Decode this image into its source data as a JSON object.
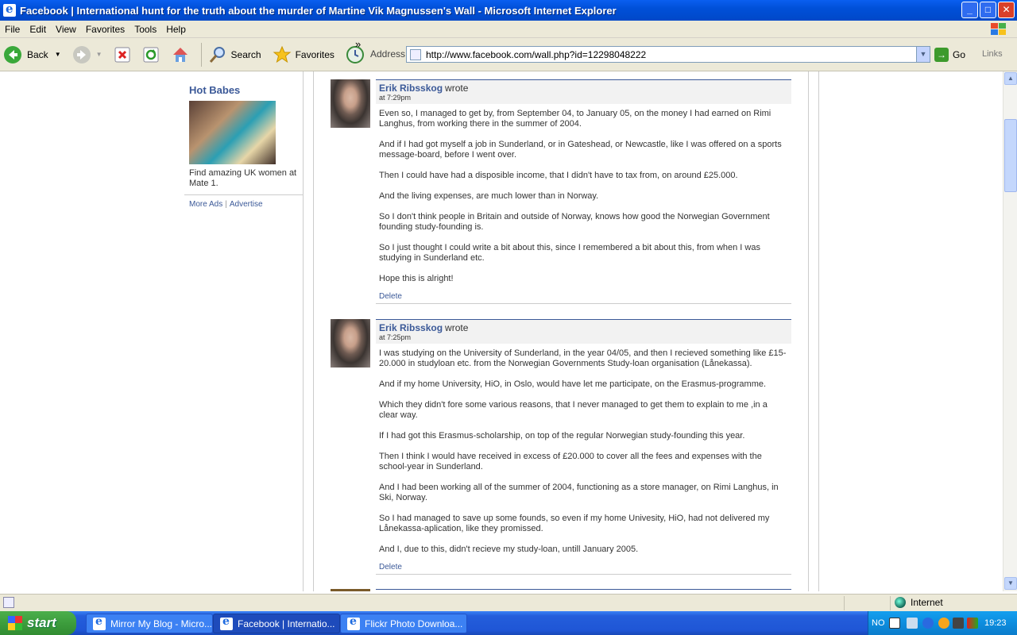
{
  "window": {
    "title": "Facebook | International hunt for the truth about the murder of Martine Vik Magnussen's Wall - Microsoft Internet Explorer",
    "controls": {
      "minimize": "_",
      "maximize": "□",
      "close": "✕"
    }
  },
  "menu": [
    "File",
    "Edit",
    "View",
    "Favorites",
    "Tools",
    "Help"
  ],
  "toolbar": {
    "back": "Back",
    "search": "Search",
    "favorites": "Favorites",
    "chevron": "»"
  },
  "address": {
    "label": "Address",
    "url": "http://www.facebook.com/wall.php?id=12298048222",
    "go": "Go",
    "links": "Links"
  },
  "ad": {
    "title": "Hot Babes",
    "text": "Find amazing UK women at Mate 1.",
    "more_ads": "More Ads",
    "separator": "|",
    "advertise": "Advertise"
  },
  "posts": [
    {
      "author": "Erik Ribsskog",
      "wrote": "wrote",
      "time": "at 7:29pm",
      "paragraphs": [
        "Even so, I managed to get by, from September 04, to January 05, on the money I had earned on Rimi Langhus, from working there in the summer of 2004.",
        "And if I had got myself a job in Sunderland, or in Gateshead, or Newcastle, like I was offered on a sports message-board, before I went over.",
        "Then I could have had a disposible income, that I didn't have to tax from, on around £25.000.",
        "And the living expenses, are much lower than in Norway.",
        "So I don't think people in Britain and outside of Norway, knows how good the Norwegian Government founding study-founding is.",
        "So I just thought I could write a bit about this, since I remembered a bit about this, from when I was studying in Sunderland etc.",
        "Hope this is alright!"
      ],
      "delete": "Delete"
    },
    {
      "author": "Erik Ribsskog",
      "wrote": "wrote",
      "time": "at 7:25pm",
      "paragraphs": [
        "I was studying on the University of Sunderland, in the year 04/05, and then I recieved something like £15-20.000 in studyloan etc. from the Norwegian Governments Study-loan organisation (Lånekassa).",
        "And if my home University, HiO, in Oslo, would have let me participate, on the Erasmus-programme.",
        "Which they didn't fore some various reasons, that I never managed to get them to explain to me ,in a clear way.",
        "If I had got this Erasmus-scholarship, on top of the regular Norwegian study-founding this year.",
        "Then I think I would have received in excess of £20.000 to cover all the fees and expenses with the school-year in Sunderland.",
        "And I had been working all of the summer of 2004, functioning as a store manager, on Rimi Langhus, in Ski, Norway.",
        "So I had managed to save up some founds, so even if my home Univesity, HiO, had not delivered my Lånekassa-aplication, like they promissed.",
        "And I, due to this, didn't recieve my study-loan, untill January 2005."
      ],
      "delete": "Delete"
    }
  ],
  "status": {
    "zone": "Internet"
  },
  "taskbar": {
    "start": "start",
    "tasks": [
      "Mirror My Blog - Micro...",
      "Facebook | Internatio...",
      "Flickr Photo Downloa..."
    ],
    "lang": "NO",
    "clock": "19:23"
  },
  "colors": {
    "facebook_blue": "#3b5998",
    "xp_blue": "#0050d8",
    "start_green": "#3d9d3d"
  }
}
